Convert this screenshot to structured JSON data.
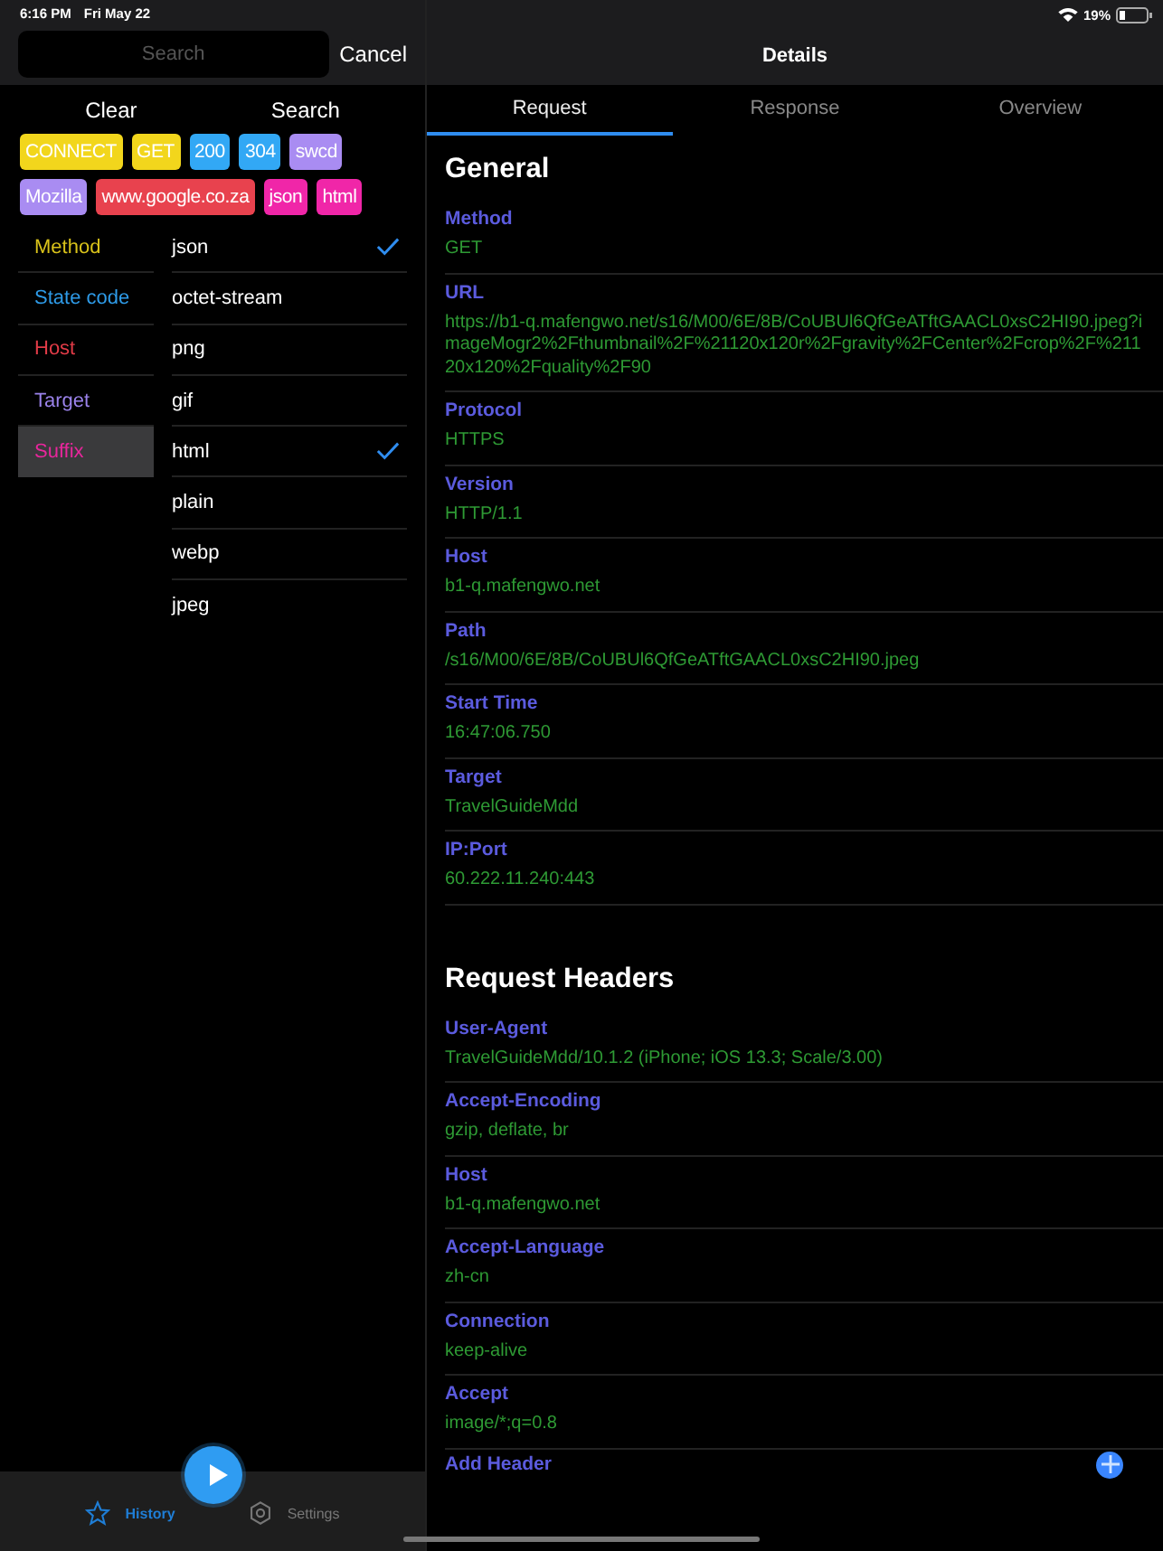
{
  "status_bar": {
    "time": "6:16 PM",
    "date": "Fri May 22",
    "battery": "19%"
  },
  "search": {
    "placeholder": "Search",
    "cancel": "Cancel"
  },
  "actions": [
    "Clear",
    "Search"
  ],
  "tags": [
    {
      "label": "CONNECT",
      "color": "#f2d61c"
    },
    {
      "label": "GET",
      "color": "#f2d61c"
    },
    {
      "label": "200",
      "color": "#32a8f5"
    },
    {
      "label": "304",
      "color": "#32a8f5"
    },
    {
      "label": "swcd",
      "color": "#a98cf2"
    },
    {
      "label": "Mozilla",
      "color": "#a98cf2"
    },
    {
      "label": "www.google.co.za",
      "color": "#e8424e"
    },
    {
      "label": "json",
      "color": "#f026a8"
    },
    {
      "label": "html",
      "color": "#f026a8"
    }
  ],
  "categories": [
    {
      "label": "Method",
      "color": "#d9c21a",
      "selected": false
    },
    {
      "label": "State code",
      "color": "#2e9be8",
      "selected": false
    },
    {
      "label": "Host",
      "color": "#e23b47",
      "selected": false
    },
    {
      "label": "Target",
      "color": "#9a82ea",
      "selected": false
    },
    {
      "label": "Suffix",
      "color": "#e8269c",
      "selected": true
    }
  ],
  "options": [
    {
      "label": "json",
      "checked": true
    },
    {
      "label": "octet-stream",
      "checked": false
    },
    {
      "label": "png",
      "checked": false
    },
    {
      "label": "gif",
      "checked": false
    },
    {
      "label": "html",
      "checked": true
    },
    {
      "label": "plain",
      "checked": false
    },
    {
      "label": "webp",
      "checked": false
    },
    {
      "label": "jpeg",
      "checked": false
    }
  ],
  "tab_bar": [
    {
      "label": "History",
      "selected": true
    },
    {
      "label": "Settings",
      "selected": false
    }
  ],
  "details": {
    "title": "Details",
    "tabs": [
      {
        "label": "Request",
        "selected": true
      },
      {
        "label": "Response",
        "selected": false
      },
      {
        "label": "Overview",
        "selected": false
      }
    ],
    "sections": [
      {
        "title": "General",
        "fields": [
          {
            "name": "Method",
            "value": "GET"
          },
          {
            "name": "URL",
            "value": "https://b1-q.mafengwo.net/s16/M00/6E/8B/CoUBUl6QfGeATftGAACL0xsC2HI90.jpeg?imageMogr2%2Fthumbnail%2F%21120x120r%2Fgravity%2FCenter%2Fcrop%2F%21120x120%2Fquality%2F90"
          },
          {
            "name": "Protocol",
            "value": "HTTPS"
          },
          {
            "name": "Version",
            "value": "HTTP/1.1"
          },
          {
            "name": "Host",
            "value": "b1-q.mafengwo.net"
          },
          {
            "name": "Path",
            "value": "/s16/M00/6E/8B/CoUBUl6QfGeATftGAACL0xsC2HI90.jpeg"
          },
          {
            "name": "Start Time",
            "value": "16:47:06.750"
          },
          {
            "name": "Target",
            "value": "TravelGuideMdd"
          },
          {
            "name": "IP:Port",
            "value": "60.222.11.240:443"
          }
        ]
      },
      {
        "title": "Request Headers",
        "fields": [
          {
            "name": "User-Agent",
            "value": "TravelGuideMdd/10.1.2 (iPhone; iOS 13.3; Scale/3.00)"
          },
          {
            "name": "Accept-Encoding",
            "value": "gzip, deflate, br"
          },
          {
            "name": "Host",
            "value": "b1-q.mafengwo.net"
          },
          {
            "name": "Accept-Language",
            "value": "zh-cn"
          },
          {
            "name": "Connection",
            "value": "keep-alive"
          },
          {
            "name": "Accept",
            "value": "image/*;q=0.8"
          }
        ]
      }
    ],
    "add_header": "Add Header"
  }
}
